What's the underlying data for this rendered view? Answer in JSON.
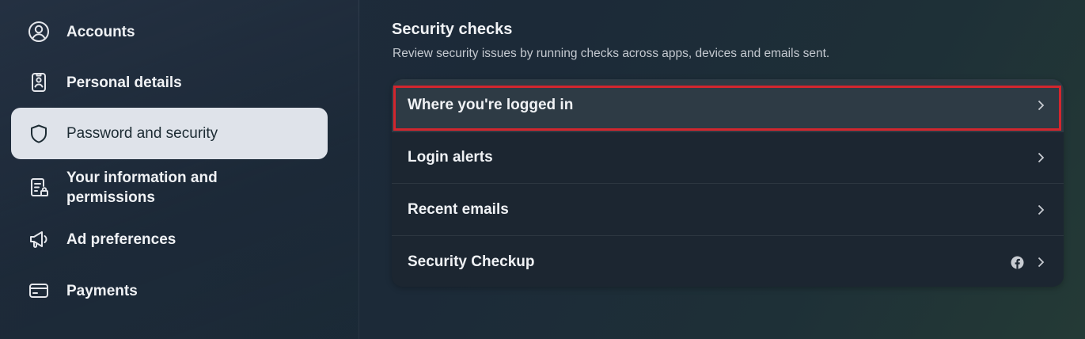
{
  "sidebar": {
    "items": [
      {
        "label": "Accounts",
        "icon": "account-circle-icon"
      },
      {
        "label": "Personal details",
        "icon": "id-card-icon"
      },
      {
        "label": "Password and security",
        "icon": "shield-icon",
        "active": true
      },
      {
        "label": "Your information and permissions",
        "icon": "document-lock-icon"
      },
      {
        "label": "Ad preferences",
        "icon": "megaphone-icon"
      },
      {
        "label": "Payments",
        "icon": "credit-card-icon"
      }
    ]
  },
  "main": {
    "title": "Security checks",
    "subtitle": "Review security issues by running checks across apps, devices and emails sent.",
    "rows": [
      {
        "label": "Where you're logged in",
        "highlighted": true
      },
      {
        "label": "Login alerts"
      },
      {
        "label": "Recent emails"
      },
      {
        "label": "Security Checkup",
        "badge_icon": "facebook-icon"
      }
    ]
  },
  "colors": {
    "highlight_border": "#d3262e",
    "active_nav_bg": "#dfe3ea"
  }
}
